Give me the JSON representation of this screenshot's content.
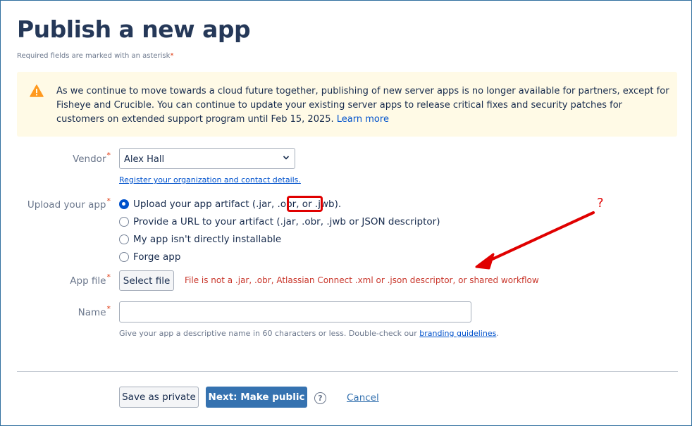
{
  "page": {
    "title": "Publish a new app",
    "required_note": "Required fields are marked with an asterisk",
    "asterisk": "*"
  },
  "warning": {
    "icon": "warning-icon",
    "text": "As we continue to move towards a cloud future together, publishing of new server apps is no longer available for partners, except for Fisheye and Crucible. You can continue to update your existing server apps to release critical fixes and security patches for customers on extended support program until Feb 15, 2025.",
    "link": "Learn more"
  },
  "vendor": {
    "label": "Vendor",
    "value": "Alex Hall",
    "help_link": "Register your organization and contact details."
  },
  "upload": {
    "label": "Upload your app",
    "options": [
      {
        "label": "Upload your app artifact (.jar, .obr, or .jwb).",
        "selected": true
      },
      {
        "label": "Provide a URL to your artifact (.jar, .obr, .jwb or JSON descriptor)",
        "selected": false
      },
      {
        "label": "My app isn't directly installable",
        "selected": false
      },
      {
        "label": "Forge app",
        "selected": false
      }
    ]
  },
  "app_file": {
    "label": "App file",
    "button": "Select file",
    "error": "File is not a .jar, .obr, Atlassian Connect .xml or .json descriptor, or shared workflow"
  },
  "name": {
    "label": "Name",
    "value": "",
    "help_prefix": "Give your app a descriptive name in 60 characters or less. Double-check our",
    "help_link": "branding guidelines",
    "help_suffix": "."
  },
  "footer": {
    "save_private": "Save as private",
    "next": "Next: Make public",
    "help_icon": "?",
    "cancel": "Cancel"
  },
  "annotation": {
    "mark": "?",
    "color": "#e00000"
  },
  "colors": {
    "title": "#253858",
    "link": "#0052cc",
    "primary_button": "#3572b0",
    "error": "#c9372c",
    "warning_bg": "#fffae6",
    "warning_icon": "#ff991f"
  }
}
